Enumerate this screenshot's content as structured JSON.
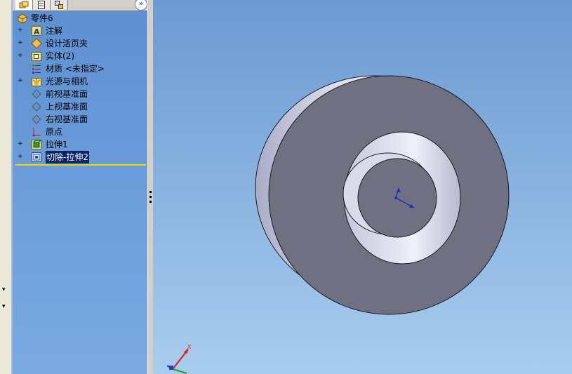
{
  "feature_tree": {
    "tabs": [
      "feature-manager-icon",
      "property-manager-icon",
      "configuration-manager-icon"
    ],
    "expand_label": "»",
    "root": {
      "label": "零件6",
      "icon": "part-icon"
    },
    "items": [
      {
        "label": "注解",
        "icon": "annotations-icon",
        "expandable": true
      },
      {
        "label": "设计活页夹",
        "icon": "design-binder-icon",
        "expandable": true
      },
      {
        "label": "实体(2)",
        "icon": "solid-bodies-icon",
        "expandable": true
      },
      {
        "label": "材质 <未指定>",
        "icon": "material-icon",
        "expandable": false
      },
      {
        "label": "光源与相机",
        "icon": "lights-camera-icon",
        "expandable": true
      },
      {
        "label": "前视基准面",
        "icon": "plane-icon",
        "expandable": false
      },
      {
        "label": "上视基准面",
        "icon": "plane-icon",
        "expandable": false
      },
      {
        "label": "右视基准面",
        "icon": "plane-icon",
        "expandable": false
      },
      {
        "label": "原点",
        "icon": "origin-icon",
        "expandable": false
      },
      {
        "label": "拉伸1",
        "icon": "extrude-icon",
        "expandable": true
      },
      {
        "label": "切除-拉伸2",
        "icon": "cut-extrude-icon",
        "expandable": true,
        "selected": true
      }
    ]
  },
  "viewport": {
    "triad_axis_label": "X",
    "colors": {
      "part_face": "#6f7081",
      "part_edge": "#1a1a22",
      "bg_top": "#6c9ad2",
      "bg_bottom": "#a9cdee"
    }
  }
}
